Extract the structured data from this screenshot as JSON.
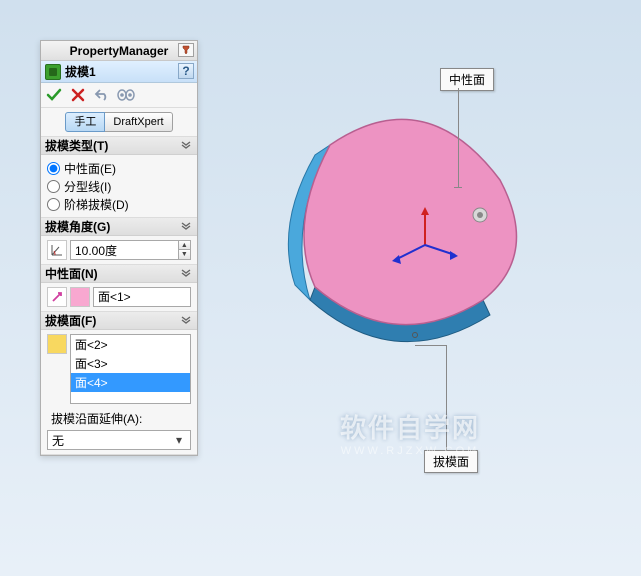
{
  "pm_title": "PropertyManager",
  "feature": {
    "name": "拔模1",
    "help": "?"
  },
  "mode": {
    "manual": "手工",
    "xpert": "DraftXpert"
  },
  "type_section": {
    "title": "拔模类型(T)",
    "options": [
      {
        "label": "中性面(E)",
        "checked": true
      },
      {
        "label": "分型线(I)",
        "checked": false
      },
      {
        "label": "阶梯拔模(D)",
        "checked": false
      }
    ]
  },
  "angle_section": {
    "title": "拔模角度(G)",
    "value": "10.00度"
  },
  "neutral_section": {
    "title": "中性面(N)",
    "item": "面<1>"
  },
  "faces_section": {
    "title": "拔模面(F)",
    "items": [
      "面<2>",
      "面<3>",
      "面<4>"
    ],
    "selected_index": 2,
    "extend_label": "拔模沿面延伸(A):",
    "extend_value": "无"
  },
  "callouts": {
    "neutral": "中性面",
    "draft": "拔模面"
  },
  "watermark": {
    "line1": "软件自学网",
    "line2": "WWW.RJZXW.COM"
  }
}
